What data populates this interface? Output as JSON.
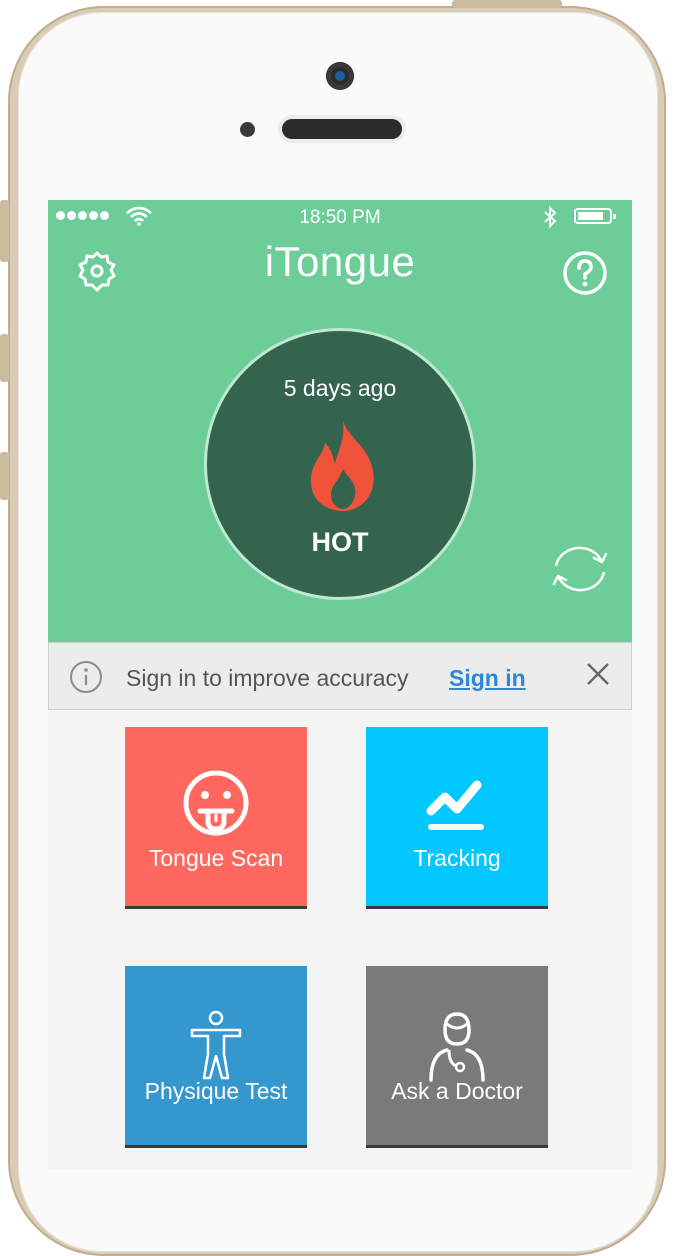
{
  "status_bar": {
    "time": "18:50 PM",
    "signal_icon": "signal-dots-icon",
    "wifi_icon": "wifi-icon",
    "bluetooth_icon": "bluetooth-icon",
    "battery_icon": "battery-icon"
  },
  "header": {
    "title": "iTongue",
    "left_icon": "gear-icon",
    "right_icon": "help-icon"
  },
  "status_circle": {
    "time_ago": "5 days ago",
    "icon": "flame-icon",
    "status": "HOT",
    "refresh_icon": "refresh-icon"
  },
  "signin_bar": {
    "message": "Sign in to improve accuracy",
    "link": "Sign in",
    "info_icon": "info-icon",
    "close_icon": "close-icon"
  },
  "tiles": [
    {
      "label": "Tongue Scan",
      "icon": "tongue-face-icon",
      "color": "#ff675f"
    },
    {
      "label": "Tracking",
      "icon": "trend-chart-icon",
      "color": "#00c8ff"
    },
    {
      "label": "Physique Test",
      "icon": "person-icon",
      "color": "#3498cf"
    },
    {
      "label": "Ask a Doctor",
      "icon": "doctor-icon",
      "color": "#7a7a7a"
    }
  ],
  "colors": {
    "header_green": "#6ccd99",
    "circle_green": "#35644e",
    "flame": "#f0533a",
    "link_blue": "#2d86d8"
  }
}
